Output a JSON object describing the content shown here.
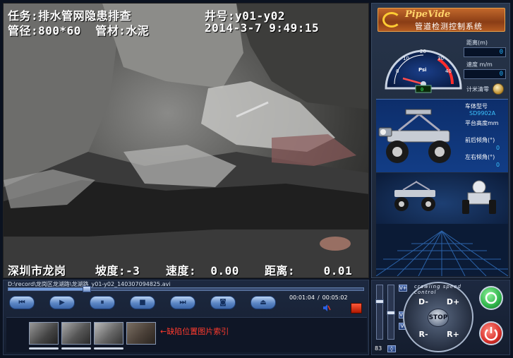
{
  "overlay": {
    "line1_task": "任务:排水管网隐患排查",
    "line1_well": "井号:y01-y02",
    "line2_pipe": "管径:800*60  管材:水泥",
    "line2_datetime": "2014-3-7 9:49:15",
    "line3_location": "深圳市龙岗",
    "line3_slope": "坡度:-3",
    "line3_speed": "速度:  0.00",
    "line3_distance": "距离:    0.01"
  },
  "logo": {
    "brand": "PipeVide",
    "system_name": "管道检测控制系统"
  },
  "gauge": {
    "unit": "Psi",
    "ticks": [
      "0",
      "10",
      "20",
      "30",
      "40"
    ],
    "readout": "0"
  },
  "readouts": {
    "distance_label": "距离(m)",
    "distance_value": "0",
    "speed_label": "速度 m/m",
    "speed_value": "0",
    "meter_reset_label": "计米清零"
  },
  "vehicle": {
    "model_label": "车体型号",
    "model_value": "SD9902A",
    "platform_height_label": "平台高度mm",
    "pitch_label": "前后倾角(°)",
    "pitch_value": "0",
    "roll_label": "左右倾角(°)",
    "roll_value": "0"
  },
  "player": {
    "file_path": "D:\\record\\龙岗区龙湖路\\龙湖路_y01-y02_140307094825.avi",
    "progress": 0.22,
    "current_time": "00:01:04",
    "total_time": "00:05:02",
    "buttons": [
      {
        "name": "prev-button",
        "glyph": "⏮"
      },
      {
        "name": "play-button",
        "glyph": "▶"
      },
      {
        "name": "pause-button",
        "glyph": "⏸"
      },
      {
        "name": "stop-playback-button",
        "glyph": "■"
      },
      {
        "name": "next-button",
        "glyph": "⏭"
      },
      {
        "name": "snapshot-button",
        "glyph": "◙"
      },
      {
        "name": "exit-button",
        "glyph": "⏏"
      }
    ]
  },
  "thumbnails": {
    "annotation": "←缺陷位置图片索引"
  },
  "controls": {
    "speed_value": "83",
    "dial_text": "crawling speed control",
    "d_minus": "D-",
    "d_plus": "D+",
    "r_minus": "R-",
    "r_plus": "R+",
    "stop": "STOP"
  },
  "colors": {
    "lcd_text": "#23b3ff",
    "annotation": "#ff3b2e",
    "start_button": "#2fb44a",
    "power_button": "#d8302a"
  }
}
